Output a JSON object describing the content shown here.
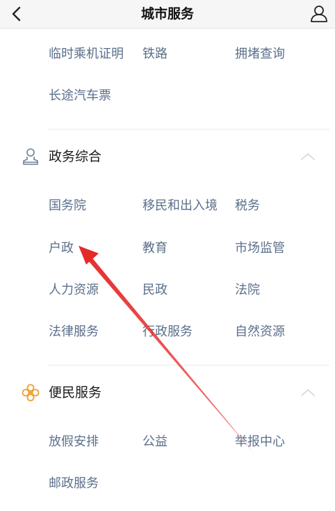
{
  "header": {
    "title": "城市服务"
  },
  "transport_section": {
    "items": [
      "临时乘机证明",
      "铁路",
      "拥堵查询",
      "长途汽车票"
    ]
  },
  "government_section": {
    "title": "政务综合",
    "icon": "official-person-icon",
    "items": [
      "国务院",
      "移民和出入境",
      "税务",
      "户政",
      "教育",
      "市场监管",
      "人力资源",
      "民政",
      "法院",
      "法律服务",
      "行政服务",
      "自然资源"
    ]
  },
  "convenience_section": {
    "title": "便民服务",
    "icon": "flower-icon",
    "items": [
      "放假安排",
      "公益",
      "举报中心",
      "邮政服务"
    ]
  },
  "colors": {
    "item_text": "#5b6f8a",
    "arrow": "#e52a2a",
    "accent_orange": "#f0a030",
    "chevron": "#d9d9d9"
  }
}
